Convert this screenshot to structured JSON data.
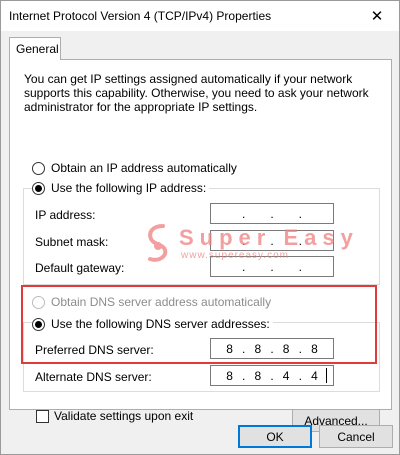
{
  "window": {
    "title": "Internet Protocol Version 4 (TCP/IPv4) Properties",
    "close_glyph": "✕"
  },
  "tabs": [
    {
      "label": "General",
      "active": true
    }
  ],
  "intro_text": "You can get IP settings assigned automatically if your network supports this capability. Otherwise, you need to ask your network administrator for the appropriate IP settings.",
  "ip_section": {
    "auto_label": "Obtain an IP address automatically",
    "auto_selected": false,
    "manual_label": "Use the following IP address:",
    "manual_selected": true,
    "fields": [
      {
        "label": "IP address:",
        "value": [
          ".",
          ".",
          "."
        ]
      },
      {
        "label": "Subnet mask:",
        "value": [
          ".",
          ".",
          "."
        ]
      },
      {
        "label": "Default gateway:",
        "value": [
          ".",
          ".",
          "."
        ]
      }
    ]
  },
  "dns_section": {
    "auto_label": "Obtain DNS server address automatically",
    "auto_selected": false,
    "auto_disabled": true,
    "manual_label": "Use the following DNS server addresses:",
    "manual_selected": true,
    "preferred": {
      "label": "Preferred DNS server:",
      "octets": [
        "8",
        "8",
        "8",
        "8"
      ]
    },
    "alternate": {
      "label": "Alternate DNS server:",
      "octets": [
        "8",
        "8",
        "4",
        "4"
      ]
    }
  },
  "validate": {
    "label": "Validate settings upon exit",
    "checked": false
  },
  "buttons": {
    "advanced": "Advanced...",
    "ok": "OK",
    "cancel": "Cancel"
  },
  "watermark": {
    "brand": "Super Easy",
    "url": "www.supereasy.com"
  },
  "colors": {
    "highlight": "#e03a3a",
    "watermark": "#f08080",
    "focus": "#0078d7"
  }
}
